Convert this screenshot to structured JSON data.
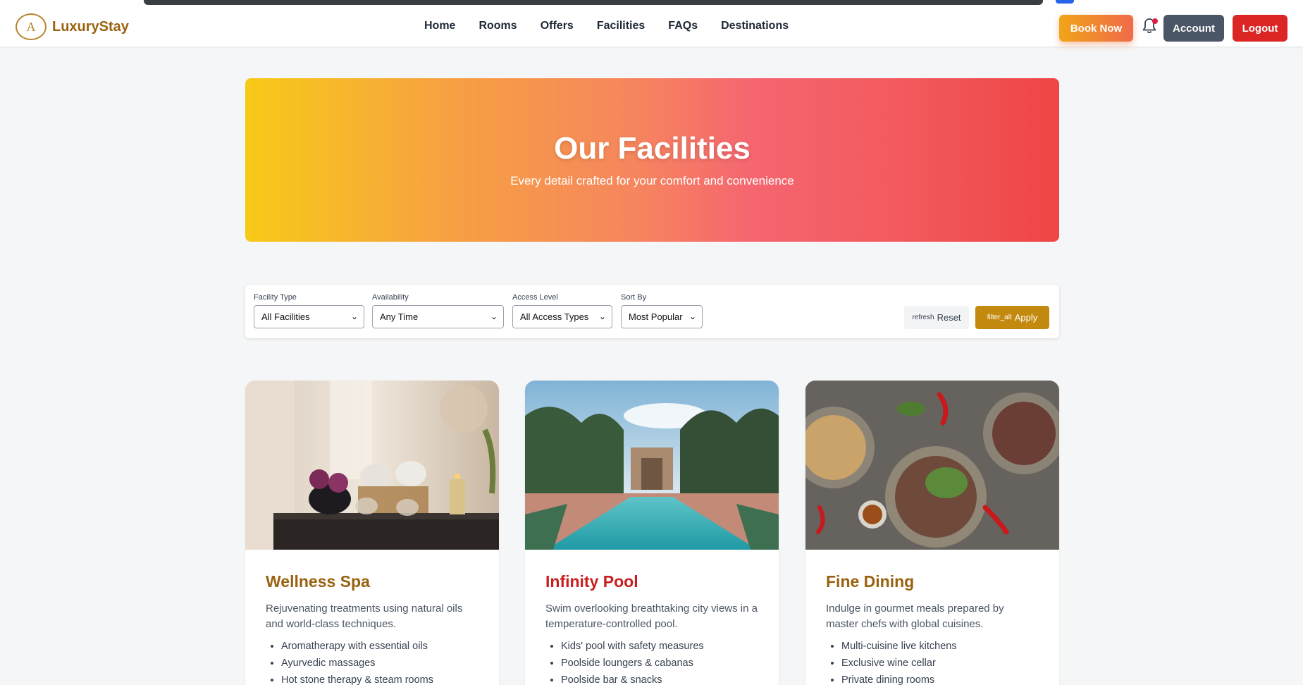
{
  "brand": {
    "name": "LuxuryStay",
    "logo_letter": "A"
  },
  "nav": {
    "links": [
      "Home",
      "Rooms",
      "Offers",
      "Facilities",
      "FAQs",
      "Destinations"
    ]
  },
  "header_actions": {
    "book": "Book Now",
    "account": "Account",
    "logout": "Logout",
    "notification_icon": "bell-icon"
  },
  "hero": {
    "title": "Our Facilities",
    "subtitle": "Every detail crafted for your comfort and convenience"
  },
  "filters": {
    "facility_type": {
      "label": "Facility Type",
      "value": "All Facilities"
    },
    "availability": {
      "label": "Availability",
      "value": "Any Time"
    },
    "access_level": {
      "label": "Access Level",
      "value": "All Access Types"
    },
    "sort_by": {
      "label": "Sort By",
      "value": "Most Popular"
    },
    "reset": {
      "icon_text": "refresh",
      "label": "Reset"
    },
    "apply": {
      "icon_text": "filter_alt",
      "label": "Apply"
    }
  },
  "cards": [
    {
      "title": "Wellness Spa",
      "title_color": "#9a6210",
      "description": "Rejuvenating treatments using natural oils and world-class techniques.",
      "features": [
        "Aromatherapy with essential oils",
        "Ayurvedic massages",
        "Hot stone therapy & steam rooms"
      ]
    },
    {
      "title": "Infinity Pool",
      "title_color": "#c81e1e",
      "description": "Swim overlooking breathtaking city views in a temperature-controlled pool.",
      "features": [
        "Kids' pool with safety measures",
        "Poolside loungers & cabanas",
        "Poolside bar & snacks"
      ]
    },
    {
      "title": "Fine Dining",
      "title_color": "#9a6210",
      "description": "Indulge in gourmet meals prepared by master chefs with global cuisines.",
      "features": [
        "Multi-cuisine live kitchens",
        "Exclusive wine cellar",
        "Private dining rooms"
      ]
    }
  ],
  "colors": {
    "brand_gold": "#b7832a",
    "apply_gold": "#c48a10",
    "logout_red": "#dc2626",
    "account_gray": "#4a5565"
  }
}
